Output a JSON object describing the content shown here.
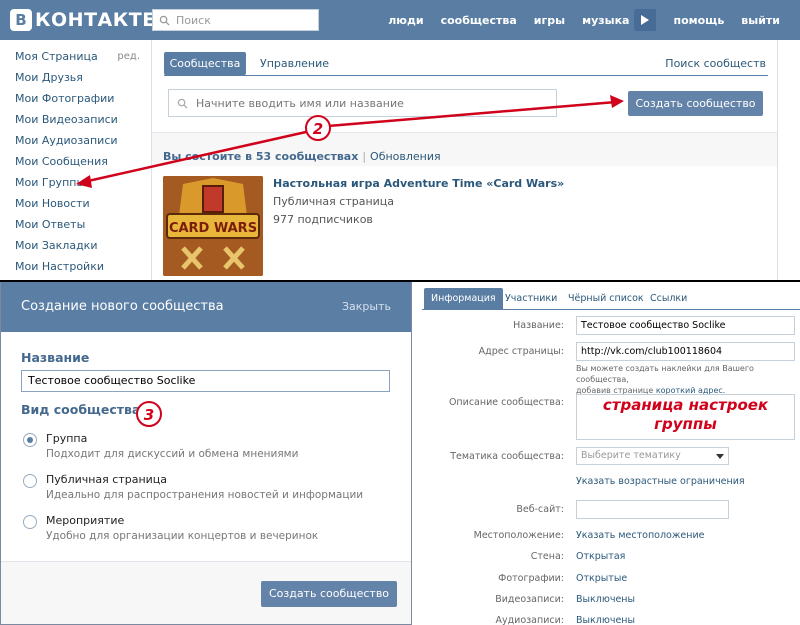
{
  "colors": {
    "header": "#597da3",
    "link": "#2b587a",
    "button": "#6383a8",
    "annotation": "#d0021b"
  },
  "header": {
    "logo_letter": "В",
    "logo_text": "КОНТАКТЕ",
    "search_placeholder": "Поиск",
    "nav": [
      "люди",
      "сообщества",
      "игры",
      "музыка",
      "помощь",
      "выйти"
    ]
  },
  "sidebar": {
    "edit_label": "ред.",
    "items": [
      "Моя Страница",
      "Мои Друзья",
      "Мои Фотографии",
      "Мои Видеозаписи",
      "Мои Аудиозаписи",
      "Мои Сообщения",
      "Мои Группы",
      "Мои Новости",
      "Мои Ответы",
      "Мои Закладки",
      "Мои Настройки"
    ]
  },
  "communities": {
    "tab_active": "Сообщества",
    "tab_manage": "Управление",
    "search_link": "Поиск сообществ",
    "search_placeholder": "Начните вводить имя или название",
    "create_button": "Создать сообщество",
    "count_text": "Вы состоите в 53 сообществах",
    "separator": "|",
    "updates_link": "Обновления",
    "group": {
      "title": "Настольная игра Adventure Time «Card Wars»",
      "type": "Публичная страница",
      "subscribers": "977 подписчиков",
      "thumb_text": "CARD WARS"
    }
  },
  "annotations": {
    "step2": "2",
    "step3": "3",
    "settings_note": "страница настроек группы"
  },
  "dialog": {
    "title": "Создание нового сообщества",
    "close": "Закрыть",
    "name_label": "Название",
    "name_value": "Тестовое сообщество Soclike",
    "type_label": "Вид сообщества",
    "options": [
      {
        "title": "Группа",
        "desc": "Подходит для дискуссий и обмена мнениями",
        "selected": true
      },
      {
        "title": "Публичная страница",
        "desc": "Идеально для распространения новостей и информации",
        "selected": false
      },
      {
        "title": "Мероприятие",
        "desc": "Удобно для организации концертов и вечеринок",
        "selected": false
      }
    ],
    "submit": "Создать сообщество"
  },
  "settings": {
    "tabs": [
      "Информация",
      "Участники",
      "Чёрный список",
      "Ссылки"
    ],
    "name_label": "Название:",
    "name_value": "Тестовое сообщество Soclike",
    "address_label": "Адрес страницы:",
    "address_value": "http://vk.com/club100118604",
    "note_line1": "Вы можете создать наклейки для Вашего сообщества,",
    "note_line2_prefix": "добавив странице ",
    "note_line2_link": "короткий адрес.",
    "description_label": "Описание сообщества:",
    "topic_label": "Тематика сообщества:",
    "topic_placeholder": "Выберите тематику",
    "age_link": "Указать возрастные ограничения",
    "website_label": "Веб-сайт:",
    "location_label": "Местоположение:",
    "location_link": "Указать местоположение",
    "wall_label": "Стена:",
    "wall_value": "Открытая",
    "photos_label": "Фотографии:",
    "photos_value": "Открытые",
    "video_label": "Видеозаписи:",
    "video_value": "Выключены",
    "audio_label": "Аудиозаписи:",
    "audio_value": "Выключены"
  }
}
